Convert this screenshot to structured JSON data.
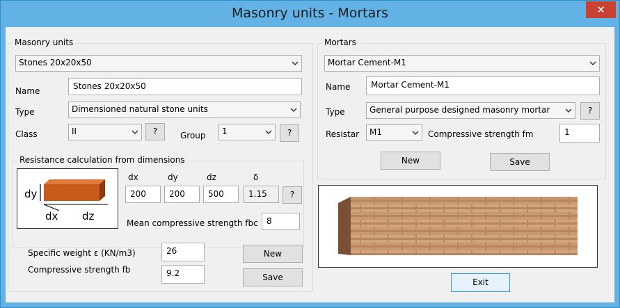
{
  "window": {
    "title": "Masonry units - Mortars",
    "close_glyph": "✕"
  },
  "masonry": {
    "group_label": "Masonry units",
    "selector": "Stones 20x20x50",
    "name_label": "Name",
    "name_value": "Stones 20x20x50",
    "type_label": "Type",
    "type_value": "Dimensioned natural stone units",
    "class_label": "Class",
    "class_value": "II",
    "group_field_label": "Group",
    "group_value": "1",
    "help": "?"
  },
  "resistance": {
    "group_label": "Resistance calculation from dimensions",
    "diagram": {
      "dy": "dy",
      "dx": "dx",
      "dz": "dz"
    },
    "dx_label": "dx",
    "dy_label": "dy",
    "dz_label": "dz",
    "delta_label": "δ",
    "dx_value": "200",
    "dy_value": "200",
    "dz_value": "500",
    "delta_value": "1.15",
    "mean_label": "Mean compressive strength fbc",
    "mean_value": "8"
  },
  "bottom": {
    "weight_label": "Specific weight ε (KN/m3)",
    "weight_value": "26",
    "fb_label": "Compressive strength fb",
    "fb_value": "9.2",
    "new_label": "New",
    "save_label": "Save"
  },
  "mortars": {
    "group_label": "Mortars",
    "selector": "Mortar Cement-M1",
    "name_label": "Name",
    "name_value": "Mortar Cement-M1",
    "type_label": "Type",
    "type_value": "General purpose designed masonry mortar",
    "resistar_label": "Resistar",
    "resistar_value": "M1",
    "fm_label": "Compressive strength fm",
    "fm_value": "1",
    "new_label": "New",
    "save_label": "Save"
  },
  "exit_label": "Exit",
  "icons": [
    "close-icon",
    "chevron-down-icon",
    "brick-diagram",
    "masonry-wall-image"
  ],
  "colors": {
    "titlebar": "#62b2e6",
    "close": "#c84131",
    "brick": "#c85a1a"
  }
}
